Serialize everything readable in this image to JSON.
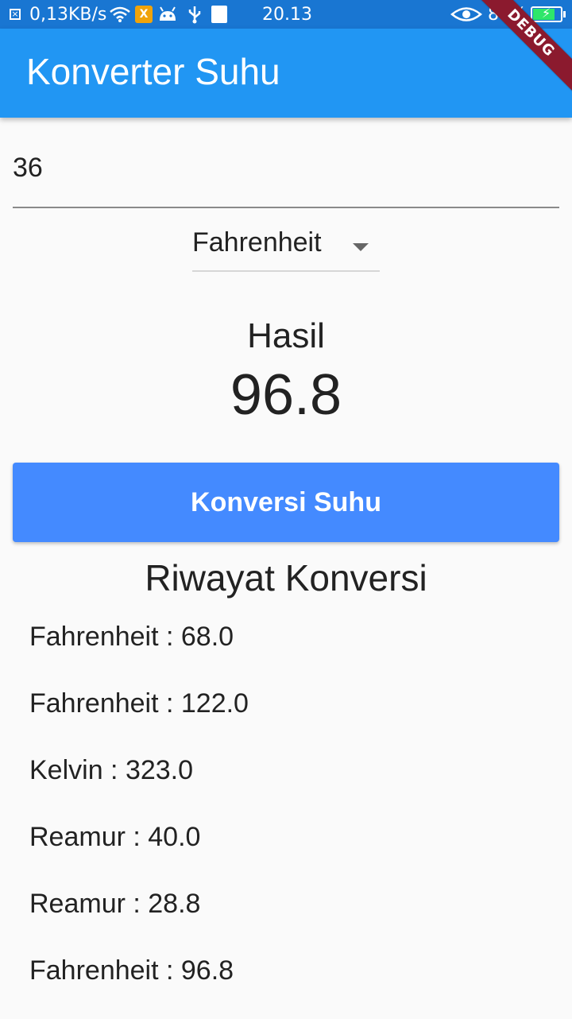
{
  "status_bar": {
    "network_speed": "0,13KB/s",
    "time": "20.13",
    "battery_level": "80%",
    "battery_fraction": 0.8,
    "icons": [
      "close-box-icon",
      "wifi-icon",
      "tool-icon",
      "android-icon",
      "usb-icon",
      "image-icon",
      "eye-icon",
      "battery-charging-icon"
    ]
  },
  "app_bar": {
    "title": "Konverter Suhu",
    "debug_banner": "DEBUG"
  },
  "input": {
    "value": "36"
  },
  "dropdown": {
    "selected": "Fahrenheit"
  },
  "result": {
    "label": "Hasil",
    "value": "96.8"
  },
  "button": {
    "label": "Konversi Suhu"
  },
  "history": {
    "title": "Riwayat Konversi",
    "items": [
      "Fahrenheit : 68.0",
      "Fahrenheit : 122.0",
      "Kelvin : 323.0",
      "Reamur : 40.0",
      "Reamur : 28.8",
      "Fahrenheit : 96.8"
    ]
  },
  "colors": {
    "status_bar": "#1976d2",
    "app_bar": "#2196f3",
    "button": "#448aff",
    "background": "#fafafa",
    "debug_ribbon": "#8b1a2e"
  }
}
